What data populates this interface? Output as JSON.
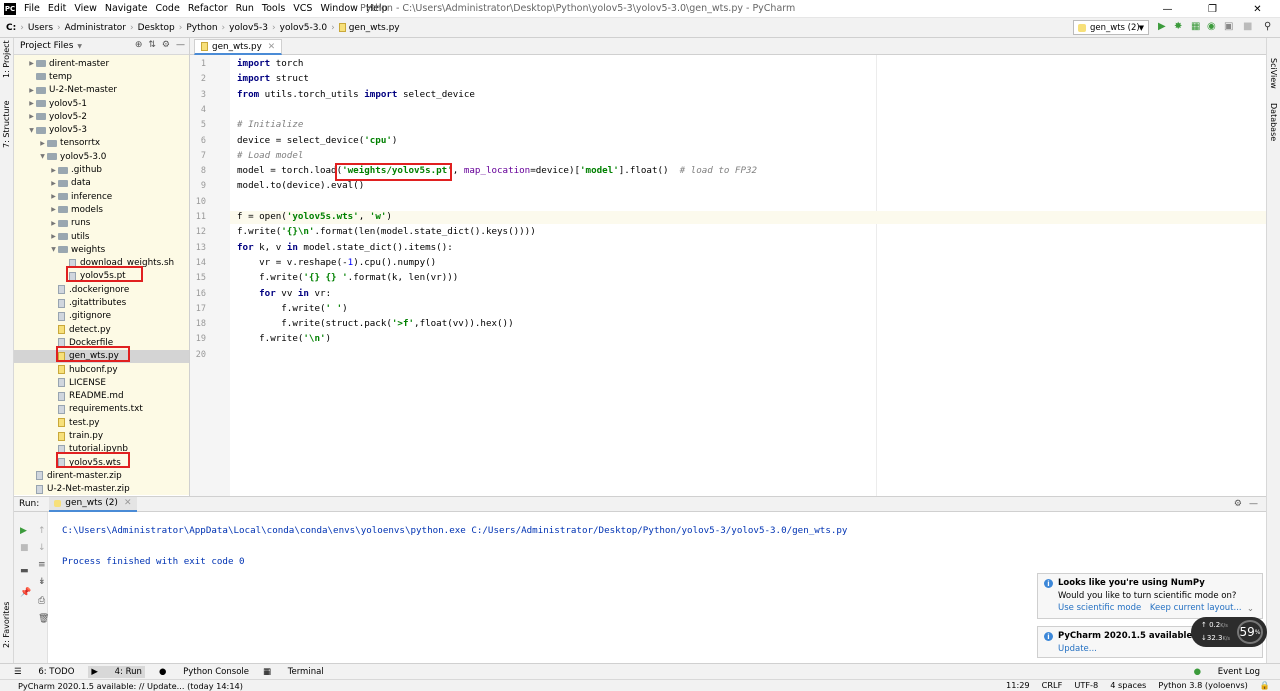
{
  "titlebar": {
    "menu": [
      "File",
      "Edit",
      "View",
      "Navigate",
      "Code",
      "Refactor",
      "Run",
      "Tools",
      "VCS",
      "Window",
      "Help"
    ],
    "title": "Python - C:\\Users\\Administrator\\Desktop\\Python\\yolov5-3\\yolov5-3.0\\gen_wts.py - PyCharm"
  },
  "nav": {
    "crumbs": [
      "C:",
      "Users",
      "Administrator",
      "Desktop",
      "Python",
      "yolov5-3",
      "yolov5-3.0",
      "gen_wts.py"
    ],
    "run_config": "gen_wts (2)"
  },
  "leftstrip": {
    "project": "1: Project",
    "structure": "7: Structure",
    "favorites": "2: Favorites"
  },
  "rightstrip": {
    "sciview": "SciView",
    "database": "Database"
  },
  "project": {
    "header": "Project Files",
    "rows": [
      {
        "label": "dirent-master",
        "type": "folder",
        "indent": 1,
        "arrow": "▶"
      },
      {
        "label": "temp",
        "type": "folder",
        "indent": 1,
        "arrow": ""
      },
      {
        "label": "U-2-Net-master",
        "type": "folder",
        "indent": 1,
        "arrow": "▶"
      },
      {
        "label": "yolov5-1",
        "type": "folder",
        "indent": 1,
        "arrow": "▶"
      },
      {
        "label": "yolov5-2",
        "type": "folder",
        "indent": 1,
        "arrow": "▶"
      },
      {
        "label": "yolov5-3",
        "type": "folder",
        "indent": 1,
        "arrow": "▼"
      },
      {
        "label": "tensorrtx",
        "type": "folder",
        "indent": 2,
        "arrow": "▶"
      },
      {
        "label": "yolov5-3.0",
        "type": "folder",
        "indent": 2,
        "arrow": "▼"
      },
      {
        "label": ".github",
        "type": "folder",
        "indent": 3,
        "arrow": "▶"
      },
      {
        "label": "data",
        "type": "folder",
        "indent": 3,
        "arrow": "▶"
      },
      {
        "label": "inference",
        "type": "folder",
        "indent": 3,
        "arrow": "▶"
      },
      {
        "label": "models",
        "type": "folder",
        "indent": 3,
        "arrow": "▶"
      },
      {
        "label": "runs",
        "type": "folder",
        "indent": 3,
        "arrow": "▶"
      },
      {
        "label": "utils",
        "type": "folder",
        "indent": 3,
        "arrow": "▶"
      },
      {
        "label": "weights",
        "type": "folder",
        "indent": 3,
        "arrow": "▼"
      },
      {
        "label": "download_weights.sh",
        "type": "file",
        "indent": 4,
        "arrow": ""
      },
      {
        "label": "yolov5s.pt",
        "type": "file",
        "indent": 4,
        "arrow": ""
      },
      {
        "label": ".dockerignore",
        "type": "file",
        "indent": 3,
        "arrow": ""
      },
      {
        "label": ".gitattributes",
        "type": "file",
        "indent": 3,
        "arrow": ""
      },
      {
        "label": ".gitignore",
        "type": "file",
        "indent": 3,
        "arrow": ""
      },
      {
        "label": "detect.py",
        "type": "py",
        "indent": 3,
        "arrow": ""
      },
      {
        "label": "Dockerfile",
        "type": "file",
        "indent": 3,
        "arrow": ""
      },
      {
        "label": "gen_wts.py",
        "type": "py",
        "indent": 3,
        "arrow": ""
      },
      {
        "label": "hubconf.py",
        "type": "py",
        "indent": 3,
        "arrow": ""
      },
      {
        "label": "LICENSE",
        "type": "file",
        "indent": 3,
        "arrow": ""
      },
      {
        "label": "README.md",
        "type": "file",
        "indent": 3,
        "arrow": ""
      },
      {
        "label": "requirements.txt",
        "type": "file",
        "indent": 3,
        "arrow": ""
      },
      {
        "label": "test.py",
        "type": "py",
        "indent": 3,
        "arrow": ""
      },
      {
        "label": "train.py",
        "type": "py",
        "indent": 3,
        "arrow": ""
      },
      {
        "label": "tutorial.ipynb",
        "type": "file",
        "indent": 3,
        "arrow": ""
      },
      {
        "label": "yolov5s.wts",
        "type": "file",
        "indent": 3,
        "arrow": ""
      },
      {
        "label": "dirent-master.zip",
        "type": "file",
        "indent": 1,
        "arrow": ""
      },
      {
        "label": "U-2-Net-master.zip",
        "type": "file",
        "indent": 1,
        "arrow": ""
      }
    ]
  },
  "editor": {
    "tab": "gen_wts.py",
    "lines": [
      "<span class=\"kw\">import</span> torch",
      "<span class=\"kw\">import</span> struct",
      "<span class=\"kw\">from</span> utils.torch_utils <span class=\"kw\">import</span> select_device",
      "",
      "<span class=\"cm\"># Initialize</span>",
      "device = select_device(<span class=\"str\">'cpu'</span>)",
      "<span class=\"cm\"># Load model</span>",
      "model = torch.load(<span class=\"str\">'weights/yolov5s.pt'</span>, <span class=\"param\">map_location</span>=device)[<span class=\"str\">'model'</span>].float()  <span class=\"cm\"># load to FP32</span>",
      "model.to(device).eval()",
      "",
      "f = open(<span class=\"str\">'yolov5s.wts'</span>, <span class=\"str\">'w'</span>)",
      "f.write(<span class=\"str\">'{}\\n'</span>.format(len(model.state_dict().keys())))",
      "<span class=\"kw\">for</span> k, v <span class=\"kw\">in</span> model.state_dict().items():",
      "    vr = v.reshape(-<span class=\"num\">1</span>).cpu().numpy()",
      "    f.write(<span class=\"str\">'{} {} '</span>.format(k, len(vr)))",
      "    <span class=\"kw\">for</span> vv <span class=\"kw\">in</span> vr:",
      "        f.write(<span class=\"str\">' '</span>)",
      "        f.write(struct.pack(<span class=\"str\">'>f'</span>,float(vv)).hex())",
      "    f.write(<span class=\"str\">'\\n'</span>)",
      ""
    ]
  },
  "run": {
    "label": "Run:",
    "tab": "gen_wts (2)",
    "command": "C:\\Users\\Administrator\\AppData\\Local\\conda\\conda\\envs\\yoloenvs\\python.exe C:/Users/Administrator/Desktop/Python/yolov5-3/yolov5-3.0/gen_wts.py",
    "finished": "Process finished with exit code 0"
  },
  "notifications": {
    "numpy_title": "Looks like you're using NumPy",
    "numpy_body": "Would you like to turn scientific mode on?",
    "numpy_link1": "Use scientific mode",
    "numpy_link2": "Keep current layout...",
    "update_title": "PyCharm 2020.1.5 available",
    "update_link": "Update..."
  },
  "widget": {
    "up": "0.2",
    "up_unit": "K/s",
    "down": "32.3",
    "down_unit": "K/s",
    "pct": "59",
    "pct_unit": "%"
  },
  "bottomtabs": {
    "todo": "6: TODO",
    "run": "4: Run",
    "console": "Python Console",
    "terminal": "Terminal",
    "eventlog": "Event Log"
  },
  "status": {
    "left": "PyCharm 2020.1.5 available: // Update... (today 14:14)",
    "pos": "11:29",
    "crlf": "CRLF",
    "enc": "UTF-8",
    "indent": "4 spaces",
    "interp": "Python 3.8 (yoloenvs)"
  }
}
